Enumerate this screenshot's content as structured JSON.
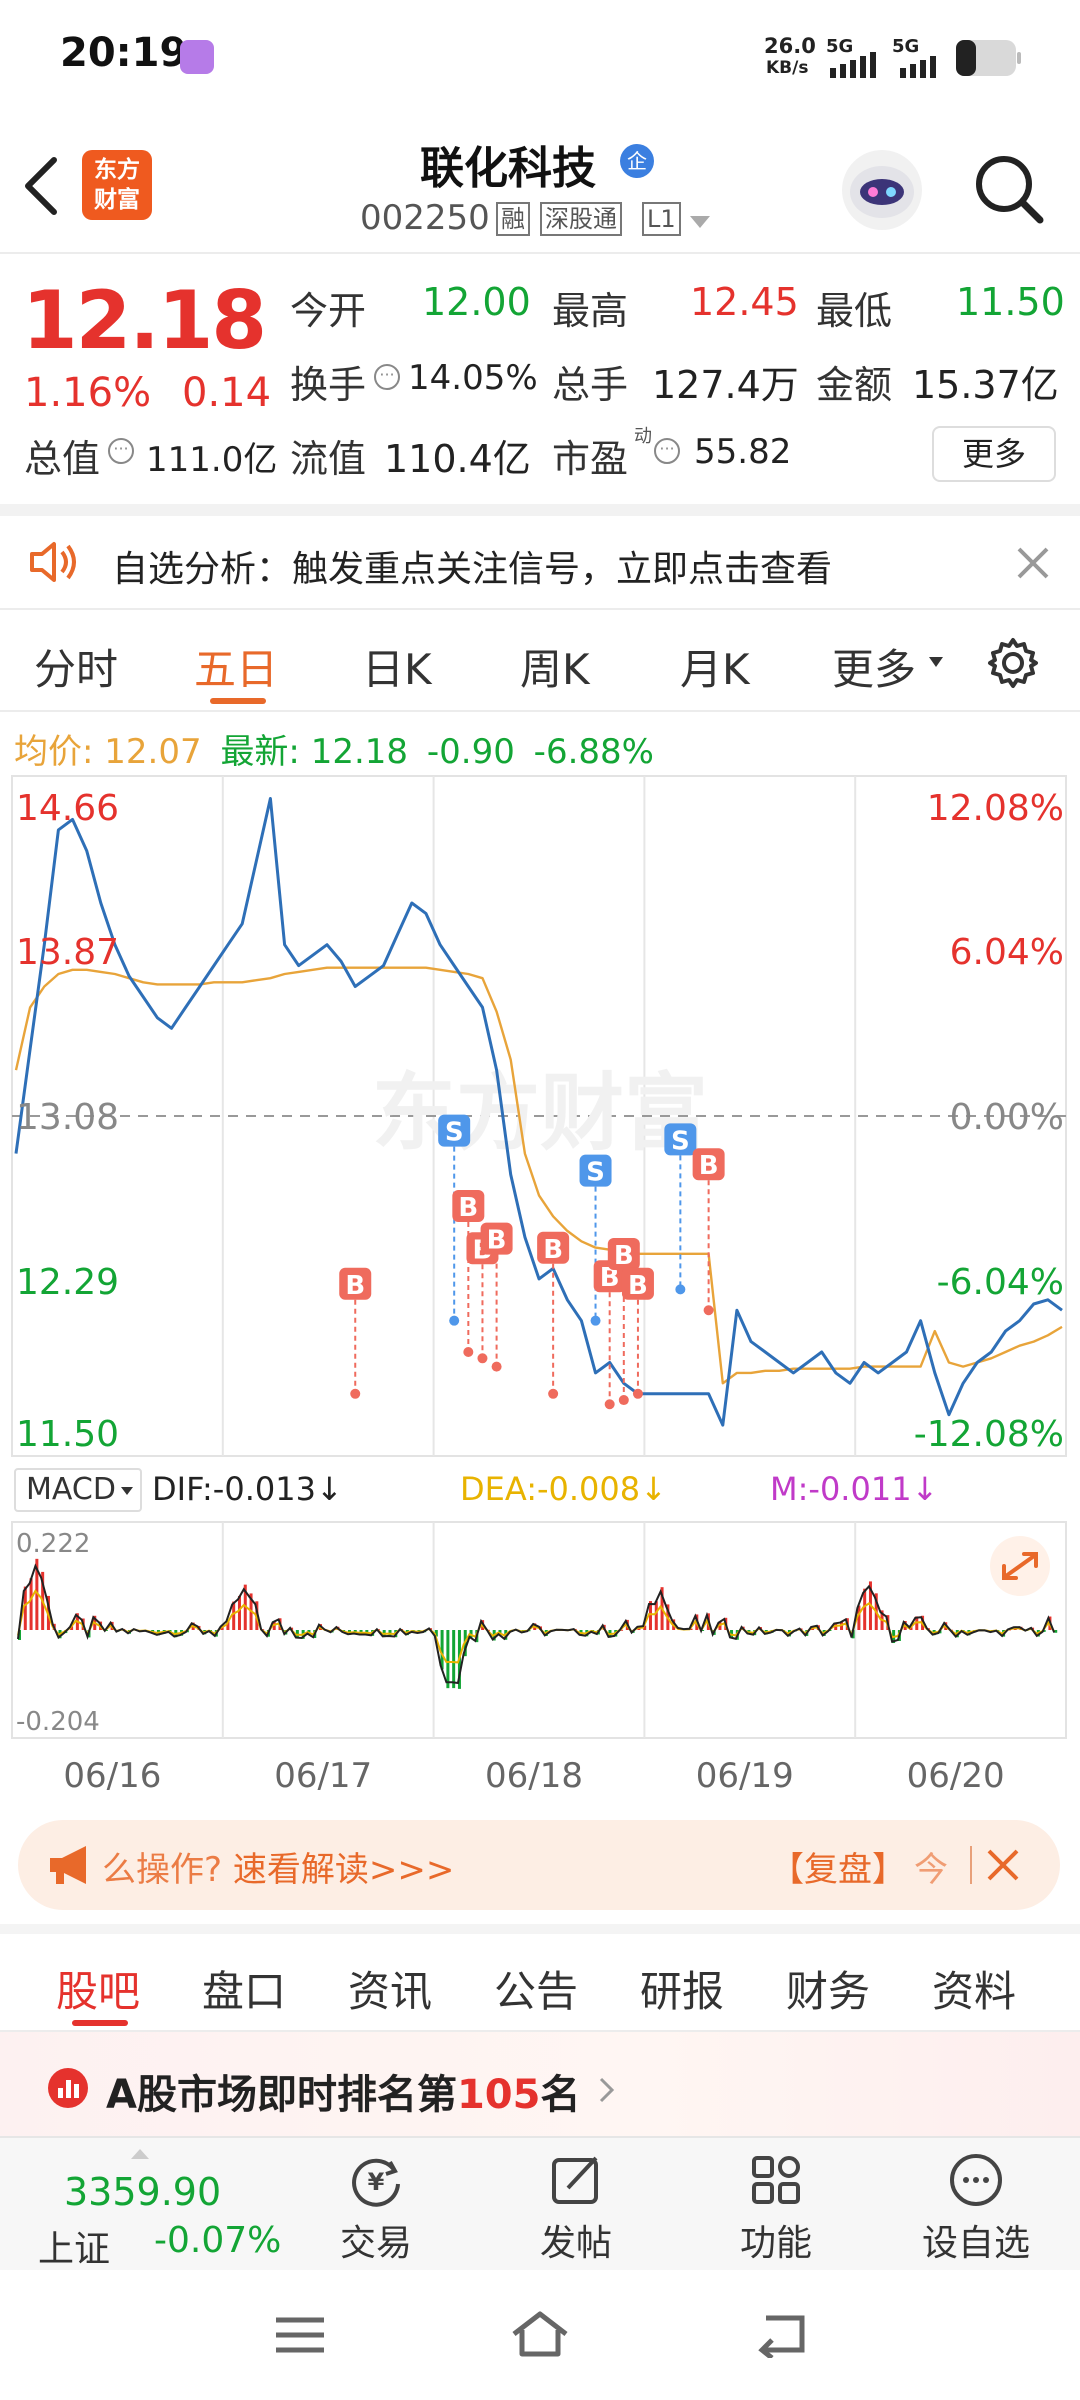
{
  "status_bar": {
    "time": "20:19",
    "net_speed_value": "26.0",
    "net_speed_unit": "KB/s",
    "sim1": "5G",
    "sim2": "5G"
  },
  "header": {
    "logo_line1": "东方",
    "logo_line2": "财富",
    "stock_name": "联化科技",
    "enterprise_badge": "企",
    "stock_code": "002250",
    "tag_margin": "融",
    "tag_connect": "深股通",
    "tag_level": "L1"
  },
  "quote": {
    "price": "12.18",
    "change_pct": "1.16%",
    "change_amt": "0.14",
    "open_label": "今开",
    "open": "12.00",
    "high_label": "最高",
    "high": "12.45",
    "low_label": "最低",
    "low": "11.50",
    "turnover_label": "换手",
    "turnover": "14.05%",
    "volume_label": "总手",
    "volume": "127.4万",
    "amount_label": "金额",
    "amount": "15.37亿",
    "mktcap_label": "总值",
    "mktcap": "111.0亿",
    "float_label": "流值",
    "float_cap": "110.4亿",
    "pe_label": "市盈",
    "pe_sup": "动",
    "pe": "55.82",
    "more_button": "更多"
  },
  "notice": {
    "text": "自选分析：触发重点关注信号，立即点击查看"
  },
  "chart_tabs": {
    "items": [
      "分时",
      "五日",
      "日K",
      "周K",
      "月K",
      "更多"
    ],
    "active": "五日"
  },
  "chart_info": {
    "avg_label": "均价:",
    "avg": "12.07",
    "latest_label": "最新:",
    "latest": "12.18",
    "change": "-0.90",
    "change_pct": "-6.88%"
  },
  "chart_data": {
    "type": "line",
    "y_axis_left": [
      "14.66",
      "13.87",
      "13.08",
      "12.29",
      "11.50"
    ],
    "y_axis_right": [
      "12.08%",
      "6.04%",
      "0.00%",
      "-6.04%",
      "-12.08%"
    ],
    "ylim": [
      11.5,
      14.66
    ],
    "x_labels": [
      "06/16",
      "06/17",
      "06/18",
      "06/19",
      "06/20"
    ],
    "series": [
      {
        "name": "price",
        "color": "#2e6fb7",
        "values": [
          12.9,
          13.4,
          13.9,
          14.45,
          14.5,
          14.35,
          14.1,
          13.9,
          13.75,
          13.65,
          13.55,
          13.5,
          13.6,
          13.7,
          13.8,
          13.9,
          14.0,
          14.3,
          14.6,
          13.9,
          13.8,
          13.85,
          13.9,
          13.82,
          13.7,
          13.75,
          13.8,
          13.95,
          14.1,
          14.05,
          13.9,
          13.8,
          13.7,
          13.6,
          13.3,
          12.8,
          12.5,
          12.3,
          12.35,
          12.2,
          12.1,
          11.85,
          11.9,
          11.8,
          11.75,
          11.75,
          11.75,
          11.75,
          11.75,
          11.75,
          11.6,
          12.15,
          12.0,
          11.95,
          11.9,
          11.85,
          11.9,
          11.95,
          11.85,
          11.8,
          11.9,
          11.85,
          11.9,
          11.95,
          12.1,
          11.85,
          11.65,
          11.8,
          11.9,
          11.95,
          12.05,
          12.1,
          12.18,
          12.2,
          12.15
        ]
      },
      {
        "name": "avg",
        "color": "#e8a43a",
        "values": [
          13.3,
          13.6,
          13.7,
          13.76,
          13.78,
          13.78,
          13.77,
          13.76,
          13.74,
          13.72,
          13.71,
          13.71,
          13.71,
          13.71,
          13.72,
          13.72,
          13.72,
          13.73,
          13.74,
          13.76,
          13.77,
          13.78,
          13.79,
          13.79,
          13.79,
          13.79,
          13.79,
          13.79,
          13.79,
          13.79,
          13.78,
          13.77,
          13.76,
          13.74,
          13.58,
          13.35,
          12.9,
          12.7,
          12.6,
          12.53,
          12.48,
          12.45,
          12.44,
          12.43,
          12.42,
          12.42,
          12.42,
          12.42,
          12.42,
          12.42,
          11.8,
          11.85,
          11.85,
          11.86,
          11.86,
          11.87,
          11.87,
          11.87,
          11.87,
          11.87,
          11.88,
          11.88,
          11.88,
          11.88,
          11.88,
          12.05,
          11.9,
          11.88,
          11.9,
          11.92,
          11.95,
          11.98,
          12.0,
          12.03,
          12.07
        ]
      }
    ],
    "signals": [
      {
        "type": "B",
        "x_index": 24,
        "price": 11.75
      },
      {
        "type": "S",
        "x_index": 31,
        "price": 12.1
      },
      {
        "type": "B",
        "x_index": 32,
        "price": 11.95
      },
      {
        "type": "B",
        "x_index": 33,
        "price": 11.92
      },
      {
        "type": "B",
        "x_index": 34,
        "price": 11.88
      },
      {
        "type": "B",
        "x_index": 38,
        "price": 11.75
      },
      {
        "type": "S",
        "x_index": 41,
        "price": 12.1
      },
      {
        "type": "B",
        "x_index": 42,
        "price": 11.7
      },
      {
        "type": "B",
        "x_index": 43,
        "price": 11.72
      },
      {
        "type": "B",
        "x_index": 44,
        "price": 11.75
      },
      {
        "type": "S",
        "x_index": 47,
        "price": 12.25
      },
      {
        "type": "B",
        "x_index": 49,
        "price": 12.15
      }
    ],
    "watermark": "东方财富"
  },
  "macd": {
    "selector": "MACD",
    "dif_label": "DIF:",
    "dif": "-0.013",
    "dea_label": "DEA:",
    "dea": "-0.008",
    "m_label": "M:",
    "m": "-0.011",
    "max": "0.222",
    "min": "-0.204"
  },
  "banner": {
    "text_prefix": "么操作?",
    "text_main": "速看解读>>>",
    "replay": "【复盘】",
    "replay_suffix": "今"
  },
  "content_tabs": {
    "items": [
      "股吧",
      "盘口",
      "资讯",
      "公告",
      "研报",
      "财务",
      "资料"
    ],
    "active": "股吧"
  },
  "ranking": {
    "prefix": "A股市场即时排名第",
    "rank": "105",
    "suffix": "名"
  },
  "bottom_bar": {
    "index_value": "3359.90",
    "index_name": "上证",
    "index_change": "-0.07%",
    "trade": "交易",
    "post": "发帖",
    "features": "功能",
    "add_watch": "设自选"
  }
}
